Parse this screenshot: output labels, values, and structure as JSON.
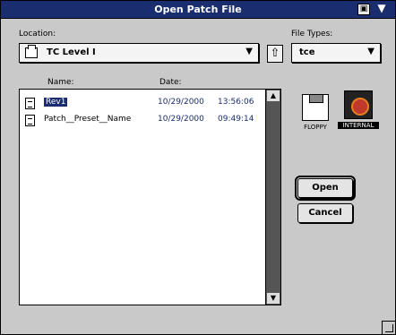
{
  "window": {
    "title": "Open Patch File",
    "zoom_icon": "zoom-box-icon",
    "collapse_icon": "collapse-triangle-icon",
    "collapse_glyph": "▼",
    "zoom_glyph": "▣"
  },
  "location": {
    "label": "Location:",
    "value": "TC Level I",
    "arrow": "▼",
    "up_glyph": "⇧"
  },
  "file_types": {
    "label": "File Types:",
    "value": "tce",
    "arrow": "▼"
  },
  "list": {
    "columns": {
      "name": "Name:",
      "date": "Date:"
    },
    "rows": [
      {
        "name": "Rev1",
        "date": "10/29/2000",
        "time": "13:56:06",
        "selected": true
      },
      {
        "name": "Patch__Preset__Name",
        "date": "10/29/2000",
        "time": "09:49:14",
        "selected": false
      }
    ]
  },
  "scrollbar": {
    "up": "▲",
    "down": "▼"
  },
  "volumes": {
    "floppy": "FLOPPY",
    "internal": "INTERNAL"
  },
  "buttons": {
    "open": "Open",
    "cancel": "Cancel"
  },
  "colors": {
    "title_bar": "#1a2d6e",
    "selection": "#1a2d6e",
    "window_bg": "#c9c9c9"
  }
}
